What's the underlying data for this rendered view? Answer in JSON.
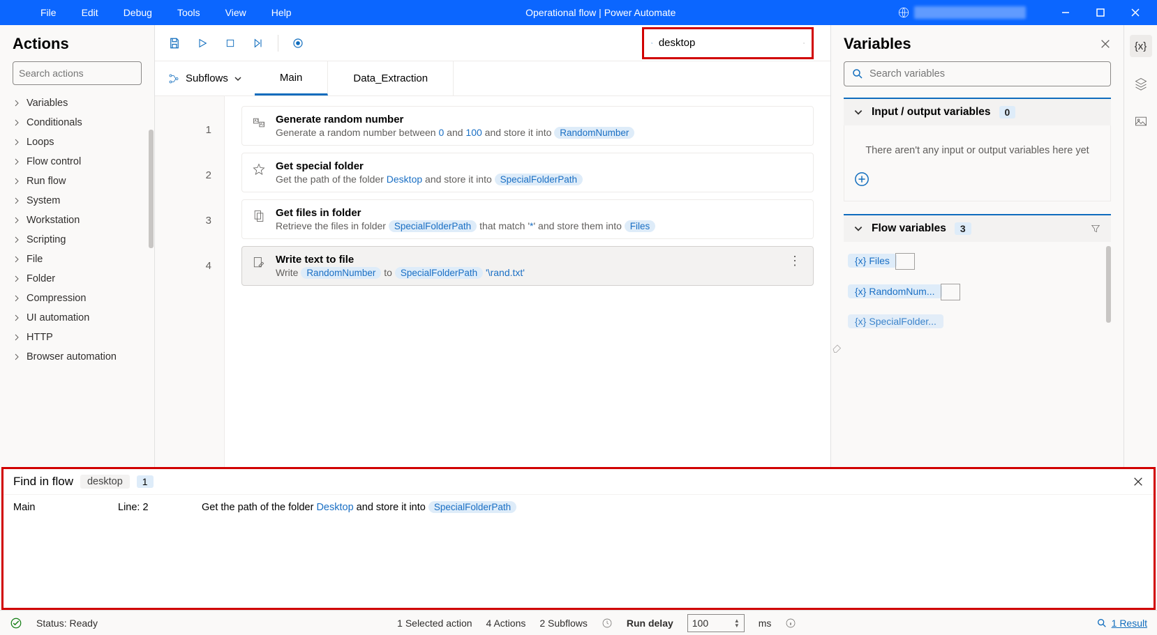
{
  "titlebar": {
    "menus": [
      "File",
      "Edit",
      "Debug",
      "Tools",
      "View",
      "Help"
    ],
    "title": "Operational flow | Power Automate"
  },
  "actions": {
    "title": "Actions",
    "search_placeholder": "Search actions",
    "categories": [
      "Variables",
      "Conditionals",
      "Loops",
      "Flow control",
      "Run flow",
      "System",
      "Workstation",
      "Scripting",
      "File",
      "Folder",
      "Compression",
      "UI automation",
      "HTTP",
      "Browser automation"
    ]
  },
  "toolbar_search": {
    "value": "desktop"
  },
  "subflows": {
    "label": "Subflows",
    "tabs": [
      "Main",
      "Data_Extraction"
    ],
    "active": 0
  },
  "steps": [
    {
      "num": "1",
      "title": "Generate random number",
      "desc_pre": "Generate a random number between ",
      "v1": "0",
      "mid": " and ",
      "v2": "100",
      "post": " and store it into ",
      "token": "RandomNumber"
    },
    {
      "num": "2",
      "title": "Get special folder",
      "desc_pre": "Get the path of the folder ",
      "v1": "Desktop",
      "mid": "",
      "v2": "",
      "post": " and store it into ",
      "token": "SpecialFolderPath"
    },
    {
      "num": "3",
      "title": "Get files in folder",
      "desc_pre": "Retrieve the files in folder ",
      "token1": "SpecialFolderPath",
      "mid": " that match '",
      "v1": "*",
      "post": "' and store them into ",
      "token": "Files"
    },
    {
      "num": "4",
      "title": "Write text to file",
      "desc_pre": "Write ",
      "token1": "RandomNumber",
      "mid": " to ",
      "token2": "SpecialFolderPath",
      "suffix": " '\\rand.txt'"
    }
  ],
  "variables": {
    "title": "Variables",
    "search_placeholder": "Search variables",
    "io_header": "Input / output variables",
    "io_count": "0",
    "io_empty": "There aren't any input or output variables here yet",
    "flow_header": "Flow variables",
    "flow_count": "3",
    "flow_vars": [
      "Files",
      "RandomNum...",
      "SpecialFolder..."
    ]
  },
  "find": {
    "title": "Find in flow",
    "term": "desktop",
    "count": "1",
    "row": {
      "subflow": "Main",
      "line": "Line: 2",
      "pre": "Get the path of the folder ",
      "blue": "Desktop",
      "mid": " and store it into ",
      "token": "SpecialFolderPath"
    }
  },
  "status": {
    "ready": "Status: Ready",
    "selected": "1 Selected action",
    "actions": "4 Actions",
    "subflows": "2 Subflows",
    "delay_label": "Run delay",
    "delay_value": "100",
    "delay_unit": "ms",
    "results": "1 Result"
  }
}
